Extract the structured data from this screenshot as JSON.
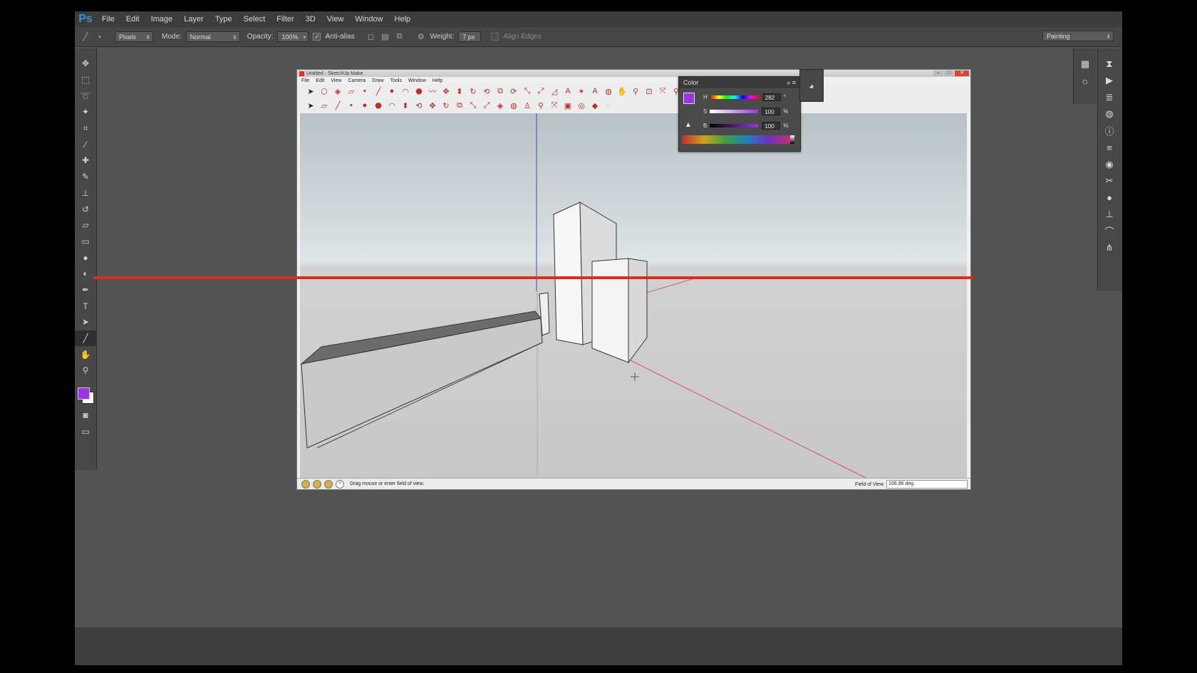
{
  "photoshop": {
    "logo": "Ps",
    "menu": [
      "File",
      "Edit",
      "Image",
      "Layer",
      "Type",
      "Select",
      "Filter",
      "3D",
      "View",
      "Window",
      "Help"
    ],
    "options": {
      "mode_select": "Pixels",
      "mode_label": "Mode:",
      "blend_mode": "Normal",
      "opacity_label": "Opacity:",
      "opacity_value": "100%",
      "antialias_label": "Anti-alias",
      "antialias_checked": true,
      "weight_label": "Weight:",
      "weight_value": "7 px",
      "align_edges_label": "Align Edges",
      "workspace": "Painting"
    },
    "tools": [
      "move-tool-icon",
      "marquee-tool-icon",
      "lasso-tool-icon",
      "quick-select-tool-icon",
      "crop-tool-icon",
      "eyedropper-tool-icon",
      "healing-brush-icon",
      "brush-tool-icon",
      "clone-stamp-icon",
      "history-brush-icon",
      "eraser-tool-icon",
      "gradient-tool-icon",
      "blur-tool-icon",
      "dodge-tool-icon",
      "pen-tool-icon",
      "type-tool-icon",
      "path-select-icon",
      "line-tool-icon",
      "hand-tool-icon",
      "zoom-tool-icon"
    ],
    "foreground_color": "#9a36e0",
    "background_color": "#ffffff",
    "guide_color": "#e22a1a"
  },
  "sketchup": {
    "title": "Untitled - SketchUp Make",
    "menu": [
      "File",
      "Edit",
      "View",
      "Camera",
      "Draw",
      "Tools",
      "Window",
      "Help"
    ],
    "status_text": "Drag mouse or enter field of view.",
    "fov_label": "Field of View",
    "fov_value": "106.96 deg."
  },
  "color_panel": {
    "title": "Color",
    "h_label": "H",
    "h_value": "282",
    "h_unit": "°",
    "s_label": "S",
    "s_value": "100",
    "s_unit": "%",
    "b_label": "B",
    "b_value": "100",
    "b_unit": "%"
  }
}
